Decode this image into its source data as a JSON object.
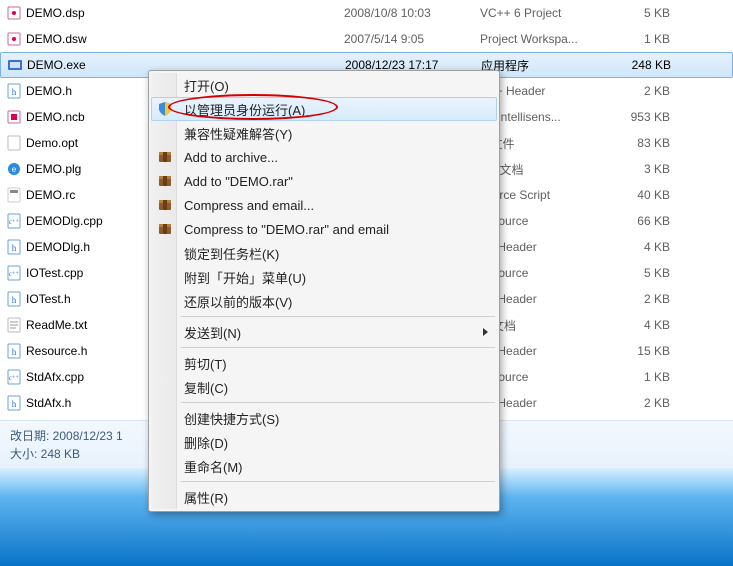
{
  "files": [
    {
      "name": "DEMO.dsp",
      "date": "2008/10/8 10:03",
      "type": "VC++ 6 Project",
      "size": "5 KB",
      "icon": "dsp"
    },
    {
      "name": "DEMO.dsw",
      "date": "2007/5/14 9:05",
      "type": "Project Workspa...",
      "size": "1 KB",
      "icon": "dsw"
    },
    {
      "name": "DEMO.exe",
      "date": "2008/12/23 17:17",
      "type": "应用程序",
      "size": "248 KB",
      "icon": "exe",
      "selected": true
    },
    {
      "name": "DEMO.h",
      "date": "",
      "type": "C++ Header",
      "size": "2 KB",
      "icon": "h"
    },
    {
      "name": "DEMO.ncb",
      "date": "",
      "type": "++ Intellisens...",
      "size": "953 KB",
      "icon": "ncb"
    },
    {
      "name": "Demo.opt",
      "date": "",
      "type": "T 文件",
      "size": "83 KB",
      "icon": "opt"
    },
    {
      "name": "DEMO.plg",
      "date": "",
      "type": "ML 文档",
      "size": "3 KB",
      "icon": "plg"
    },
    {
      "name": "DEMO.rc",
      "date": "",
      "type": "source Script",
      "size": "40 KB",
      "icon": "rc"
    },
    {
      "name": "DEMODlg.cpp",
      "date": "",
      "type": "+ Source",
      "size": "66 KB",
      "icon": "cpp"
    },
    {
      "name": "DEMODlg.h",
      "date": "",
      "type": "++ Header",
      "size": "4 KB",
      "icon": "h"
    },
    {
      "name": "IOTest.cpp",
      "date": "",
      "type": "+ Source",
      "size": "5 KB",
      "icon": "cpp"
    },
    {
      "name": "IOTest.h",
      "date": "",
      "type": "++ Header",
      "size": "2 KB",
      "icon": "h"
    },
    {
      "name": "ReadMe.txt",
      "date": "",
      "type": "本文档",
      "size": "4 KB",
      "icon": "txt"
    },
    {
      "name": "Resource.h",
      "date": "",
      "type": "++ Header",
      "size": "15 KB",
      "icon": "h"
    },
    {
      "name": "StdAfx.cpp",
      "date": "",
      "type": "+ Source",
      "size": "1 KB",
      "icon": "cpp"
    },
    {
      "name": "StdAfx.h",
      "date": "",
      "type": "++ Header",
      "size": "2 KB",
      "icon": "h"
    }
  ],
  "status": {
    "line1": "改日期: 2008/12/23 1",
    "line2": "大小: 248 KB"
  },
  "menu": {
    "items": [
      {
        "label": "打开(O)",
        "icon": "",
        "type": "item"
      },
      {
        "label": "以管理员身份运行(A)",
        "icon": "shield",
        "type": "item",
        "hover": true
      },
      {
        "label": "兼容性疑难解答(Y)",
        "icon": "",
        "type": "item"
      },
      {
        "label": "Add to archive...",
        "icon": "rar",
        "type": "item"
      },
      {
        "label": "Add to \"DEMO.rar\"",
        "icon": "rar",
        "type": "item"
      },
      {
        "label": "Compress and email...",
        "icon": "rar",
        "type": "item"
      },
      {
        "label": "Compress to \"DEMO.rar\" and email",
        "icon": "rar",
        "type": "item"
      },
      {
        "label": "锁定到任务栏(K)",
        "icon": "",
        "type": "item"
      },
      {
        "label": "附到「开始」菜单(U)",
        "icon": "",
        "type": "item"
      },
      {
        "label": "还原以前的版本(V)",
        "icon": "",
        "type": "item"
      },
      {
        "type": "sep"
      },
      {
        "label": "发送到(N)",
        "icon": "",
        "type": "item",
        "arrow": true
      },
      {
        "type": "sep"
      },
      {
        "label": "剪切(T)",
        "icon": "",
        "type": "item"
      },
      {
        "label": "复制(C)",
        "icon": "",
        "type": "item"
      },
      {
        "type": "sep"
      },
      {
        "label": "创建快捷方式(S)",
        "icon": "",
        "type": "item"
      },
      {
        "label": "删除(D)",
        "icon": "",
        "type": "item"
      },
      {
        "label": "重命名(M)",
        "icon": "",
        "type": "item"
      },
      {
        "type": "sep"
      },
      {
        "label": "属性(R)",
        "icon": "",
        "type": "item"
      }
    ]
  }
}
